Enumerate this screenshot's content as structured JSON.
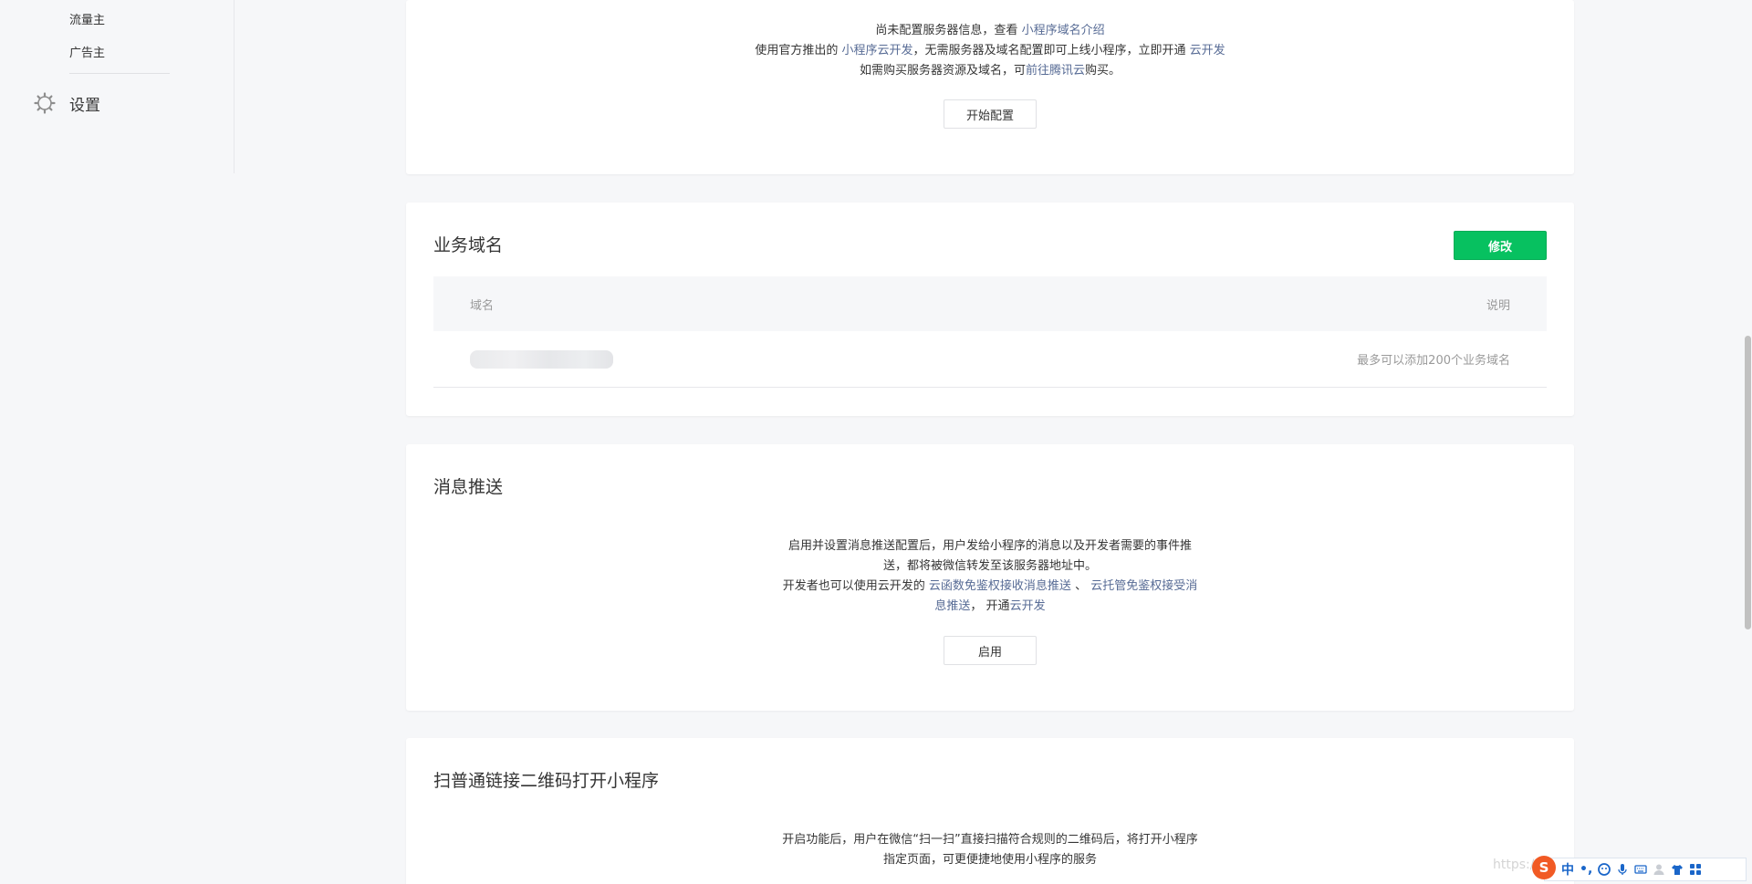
{
  "sidebar": {
    "items": [
      {
        "label": "流量主"
      },
      {
        "label": "广告主"
      }
    ],
    "settings_label": "设置"
  },
  "server_card": {
    "line1_pre": "尚未配置服务器信息，查看",
    "line1_link": "小程序域名介绍",
    "line2_pre": "使用官方推出的",
    "line2_link1": "小程序云开发",
    "line2_mid": "，无需服务器及域名配置即可上线小程序，立即开通",
    "line2_link2": "云开发",
    "line3_pre": "如需购买服务器资源及域名，可",
    "line3_link": "前往腾讯云",
    "line3_post": "购买。",
    "button_label": "开始配置"
  },
  "domain_card": {
    "title": "业务域名",
    "edit_label": "修改",
    "columns": [
      "域名",
      "说明"
    ],
    "rows": [
      {
        "domain": "",
        "note": "最多可以添加200个业务域名"
      }
    ]
  },
  "push_card": {
    "title": "消息推送",
    "line1": "启用并设置消息推送配置后，用户发给小程序的消息以及开发者需要的事件推",
    "line2": "送，都将被微信转发至该服务器地址中。",
    "line3_pre": "开发者也可以使用云开发的",
    "line3_link1": "云函数免鉴权接收消息推送",
    "line3_sep": "、",
    "line3_link2a": "云托管免鉴权接受消",
    "line4_link2b": "息推送",
    "line4_mid": "，  开通",
    "line4_link3": "云开发",
    "button_label": "启用"
  },
  "qr_card": {
    "title": "扫普通链接二维码打开小程序",
    "line1": "开启功能后，用户在微信“扫一扫”直接扫描符合规则的二维码后，将打开小程序",
    "line2": "指定页面，可更便捷地使用小程序的服务"
  },
  "watermark": "https://b",
  "ime": {
    "logo": "S",
    "mode": "中",
    "punct": "•,",
    "icons": [
      "emoji-icon",
      "microphone-icon",
      "keyboard-icon",
      "user-icon",
      "shirt-icon",
      "grid-icon"
    ]
  },
  "colors": {
    "link": "#576b95",
    "primary": "#07c160",
    "background": "#f6f7f9",
    "ime_brand": "#f15a24"
  }
}
